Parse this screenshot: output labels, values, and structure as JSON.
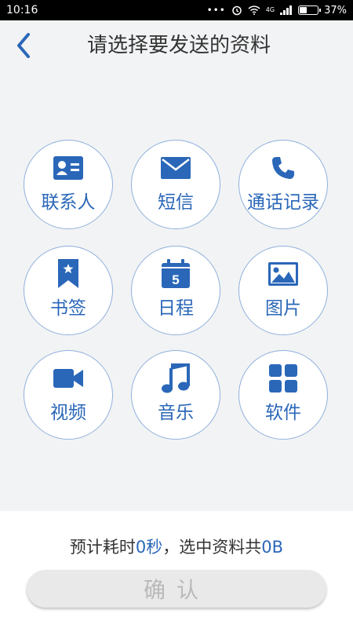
{
  "status_bar": {
    "time": "10:16",
    "network": "4G",
    "battery_percent": "37%",
    "battery_level": 0.37
  },
  "header": {
    "title": "请选择要发送的资料"
  },
  "grid": {
    "items": [
      {
        "label": "联系人",
        "icon": "contact-card-icon"
      },
      {
        "label": "短信",
        "icon": "envelope-icon"
      },
      {
        "label": "通话记录",
        "icon": "phone-icon"
      },
      {
        "label": "书签",
        "icon": "bookmark-icon"
      },
      {
        "label": "日程",
        "icon": "calendar-icon"
      },
      {
        "label": "图片",
        "icon": "picture-icon"
      },
      {
        "label": "视频",
        "icon": "video-camera-icon"
      },
      {
        "label": "音乐",
        "icon": "music-note-icon"
      },
      {
        "label": "软件",
        "icon": "apps-grid-icon"
      }
    ]
  },
  "summary": {
    "prefix": "预计耗时",
    "time_value": "0秒",
    "middle": "，选中资料共",
    "size_value": "0B"
  },
  "confirm": {
    "label": "确认"
  },
  "colors": {
    "accent": "#2a67b8",
    "circle_border": "#8fb0dd",
    "background": "#f2f3f4"
  }
}
